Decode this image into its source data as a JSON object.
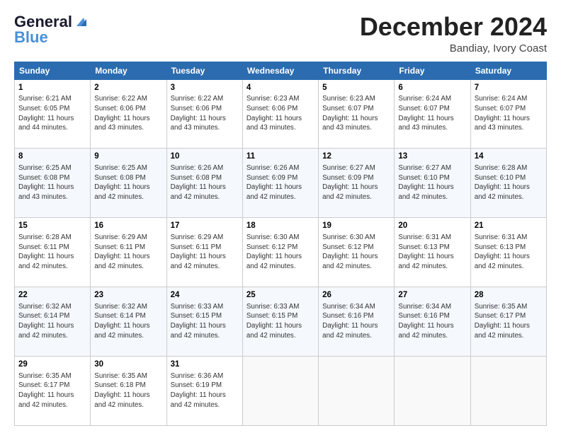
{
  "header": {
    "logo_line1": "General",
    "logo_line2": "Blue",
    "month_title": "December 2024",
    "location": "Bandiay, Ivory Coast"
  },
  "days_of_week": [
    "Sunday",
    "Monday",
    "Tuesday",
    "Wednesday",
    "Thursday",
    "Friday",
    "Saturday"
  ],
  "weeks": [
    [
      {
        "day": 1,
        "info": "Sunrise: 6:21 AM\nSunset: 6:05 PM\nDaylight: 11 hours\nand 44 minutes."
      },
      {
        "day": 2,
        "info": "Sunrise: 6:22 AM\nSunset: 6:06 PM\nDaylight: 11 hours\nand 43 minutes."
      },
      {
        "day": 3,
        "info": "Sunrise: 6:22 AM\nSunset: 6:06 PM\nDaylight: 11 hours\nand 43 minutes."
      },
      {
        "day": 4,
        "info": "Sunrise: 6:23 AM\nSunset: 6:06 PM\nDaylight: 11 hours\nand 43 minutes."
      },
      {
        "day": 5,
        "info": "Sunrise: 6:23 AM\nSunset: 6:07 PM\nDaylight: 11 hours\nand 43 minutes."
      },
      {
        "day": 6,
        "info": "Sunrise: 6:24 AM\nSunset: 6:07 PM\nDaylight: 11 hours\nand 43 minutes."
      },
      {
        "day": 7,
        "info": "Sunrise: 6:24 AM\nSunset: 6:07 PM\nDaylight: 11 hours\nand 43 minutes."
      }
    ],
    [
      {
        "day": 8,
        "info": "Sunrise: 6:25 AM\nSunset: 6:08 PM\nDaylight: 11 hours\nand 43 minutes."
      },
      {
        "day": 9,
        "info": "Sunrise: 6:25 AM\nSunset: 6:08 PM\nDaylight: 11 hours\nand 42 minutes."
      },
      {
        "day": 10,
        "info": "Sunrise: 6:26 AM\nSunset: 6:08 PM\nDaylight: 11 hours\nand 42 minutes."
      },
      {
        "day": 11,
        "info": "Sunrise: 6:26 AM\nSunset: 6:09 PM\nDaylight: 11 hours\nand 42 minutes."
      },
      {
        "day": 12,
        "info": "Sunrise: 6:27 AM\nSunset: 6:09 PM\nDaylight: 11 hours\nand 42 minutes."
      },
      {
        "day": 13,
        "info": "Sunrise: 6:27 AM\nSunset: 6:10 PM\nDaylight: 11 hours\nand 42 minutes."
      },
      {
        "day": 14,
        "info": "Sunrise: 6:28 AM\nSunset: 6:10 PM\nDaylight: 11 hours\nand 42 minutes."
      }
    ],
    [
      {
        "day": 15,
        "info": "Sunrise: 6:28 AM\nSunset: 6:11 PM\nDaylight: 11 hours\nand 42 minutes."
      },
      {
        "day": 16,
        "info": "Sunrise: 6:29 AM\nSunset: 6:11 PM\nDaylight: 11 hours\nand 42 minutes."
      },
      {
        "day": 17,
        "info": "Sunrise: 6:29 AM\nSunset: 6:11 PM\nDaylight: 11 hours\nand 42 minutes."
      },
      {
        "day": 18,
        "info": "Sunrise: 6:30 AM\nSunset: 6:12 PM\nDaylight: 11 hours\nand 42 minutes."
      },
      {
        "day": 19,
        "info": "Sunrise: 6:30 AM\nSunset: 6:12 PM\nDaylight: 11 hours\nand 42 minutes."
      },
      {
        "day": 20,
        "info": "Sunrise: 6:31 AM\nSunset: 6:13 PM\nDaylight: 11 hours\nand 42 minutes."
      },
      {
        "day": 21,
        "info": "Sunrise: 6:31 AM\nSunset: 6:13 PM\nDaylight: 11 hours\nand 42 minutes."
      }
    ],
    [
      {
        "day": 22,
        "info": "Sunrise: 6:32 AM\nSunset: 6:14 PM\nDaylight: 11 hours\nand 42 minutes."
      },
      {
        "day": 23,
        "info": "Sunrise: 6:32 AM\nSunset: 6:14 PM\nDaylight: 11 hours\nand 42 minutes."
      },
      {
        "day": 24,
        "info": "Sunrise: 6:33 AM\nSunset: 6:15 PM\nDaylight: 11 hours\nand 42 minutes."
      },
      {
        "day": 25,
        "info": "Sunrise: 6:33 AM\nSunset: 6:15 PM\nDaylight: 11 hours\nand 42 minutes."
      },
      {
        "day": 26,
        "info": "Sunrise: 6:34 AM\nSunset: 6:16 PM\nDaylight: 11 hours\nand 42 minutes."
      },
      {
        "day": 27,
        "info": "Sunrise: 6:34 AM\nSunset: 6:16 PM\nDaylight: 11 hours\nand 42 minutes."
      },
      {
        "day": 28,
        "info": "Sunrise: 6:35 AM\nSunset: 6:17 PM\nDaylight: 11 hours\nand 42 minutes."
      }
    ],
    [
      {
        "day": 29,
        "info": "Sunrise: 6:35 AM\nSunset: 6:17 PM\nDaylight: 11 hours\nand 42 minutes."
      },
      {
        "day": 30,
        "info": "Sunrise: 6:35 AM\nSunset: 6:18 PM\nDaylight: 11 hours\nand 42 minutes."
      },
      {
        "day": 31,
        "info": "Sunrise: 6:36 AM\nSunset: 6:19 PM\nDaylight: 11 hours\nand 42 minutes."
      },
      null,
      null,
      null,
      null
    ]
  ]
}
